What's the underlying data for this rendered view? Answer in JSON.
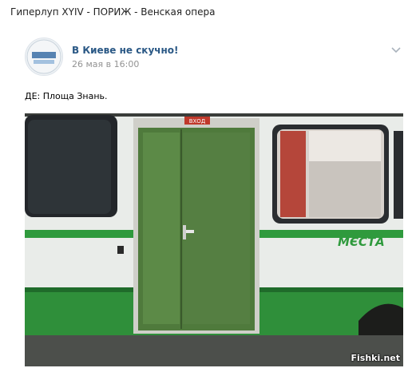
{
  "header": {
    "title": "Гиперлуп XYIV - ПОРИЖ - Венская опера"
  },
  "post": {
    "author": "В Киеве не скучно!",
    "date": "26 мая в 16:00",
    "text": "ДЕ: Площа Знань.",
    "avatar_label": "В КИЕВЕ НЕ СКУЧНО",
    "menu_icon": "chevron-down-icon",
    "image": {
      "description_icon": "bus-photo",
      "bus_sign": "ВХОД",
      "bus_text": "МЄСТА",
      "watermark": "Fishki.net"
    }
  },
  "colors": {
    "link": "#2a5885",
    "muted": "#939393",
    "bus_green": "#2e9a3a",
    "door_green": "#4f7a3c"
  }
}
